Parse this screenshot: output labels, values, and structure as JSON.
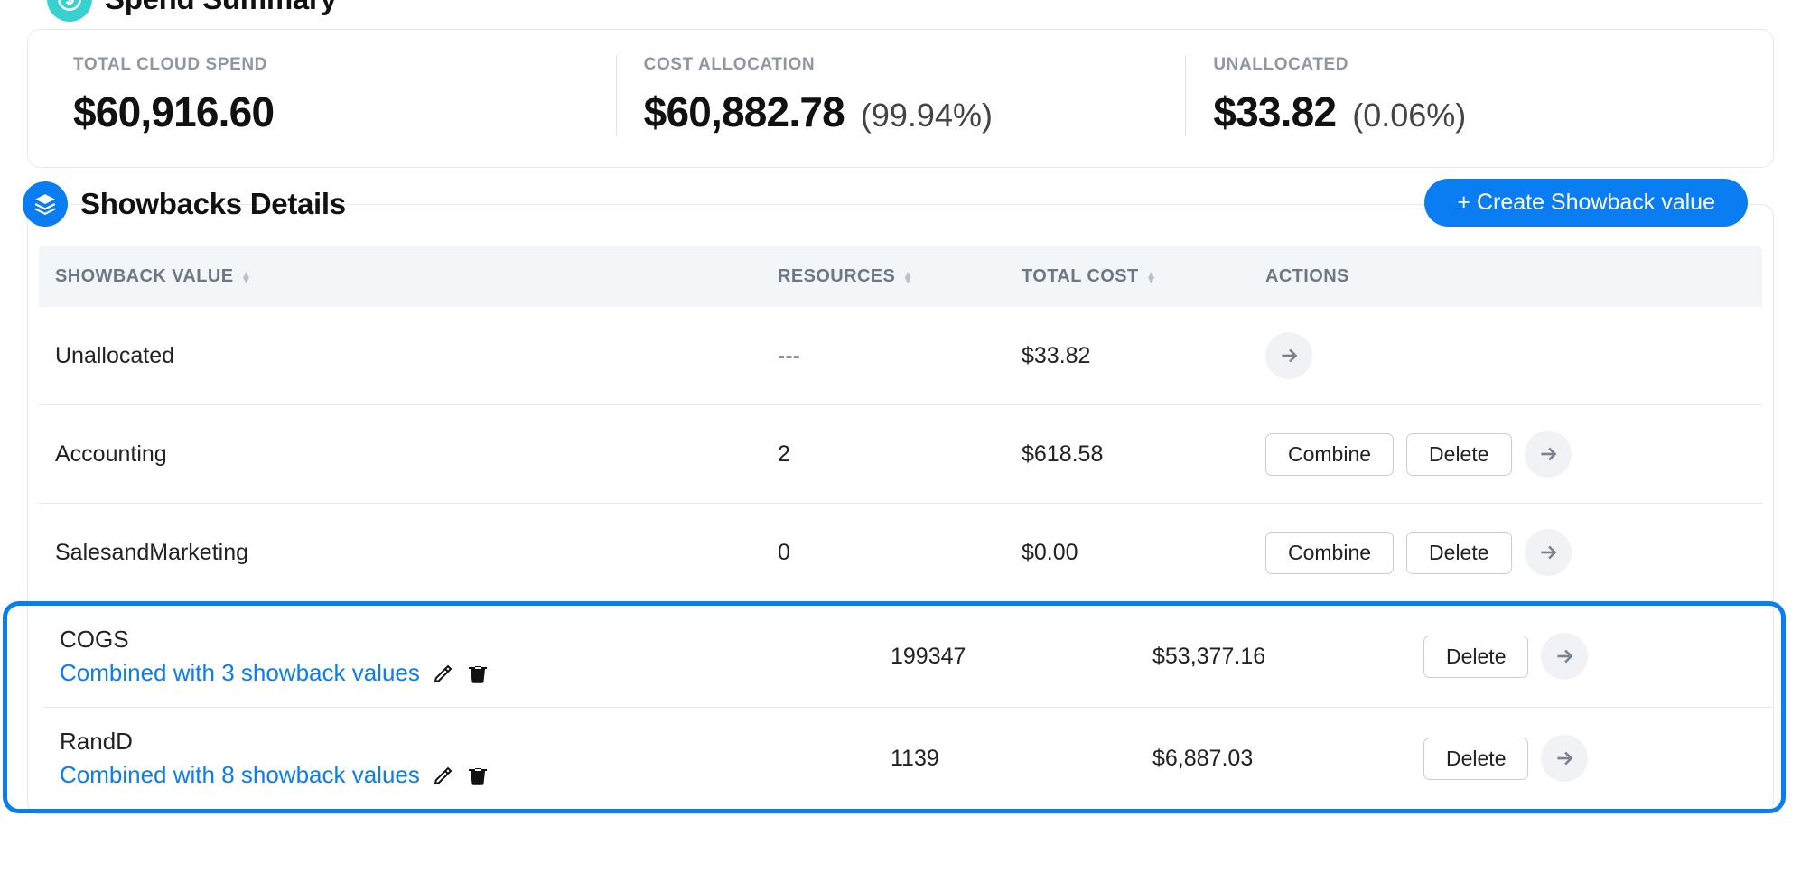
{
  "spendSummary": {
    "title": "Spend Summary",
    "metrics": [
      {
        "label": "TOTAL CLOUD SPEND",
        "value": "$60,916.60",
        "pct": ""
      },
      {
        "label": "COST ALLOCATION",
        "value": "$60,882.78",
        "pct": "(99.94%)"
      },
      {
        "label": "UNALLOCATED",
        "value": "$33.82",
        "pct": "(0.06%)"
      }
    ]
  },
  "showbacks": {
    "title": "Showbacks Details",
    "createLabel": "+ Create Showback value",
    "columns": {
      "showback": "SHOWBACK VALUE",
      "resources": "RESOURCES",
      "cost": "TOTAL COST",
      "actions": "ACTIONS"
    },
    "buttons": {
      "combine": "Combine",
      "delete": "Delete"
    },
    "rows": [
      {
        "name": "Unallocated",
        "resources": "---",
        "cost": "$33.82",
        "combine": false,
        "delete": false
      },
      {
        "name": "Accounting",
        "resources": "2",
        "cost": "$618.58",
        "combine": true,
        "delete": true
      },
      {
        "name": "SalesandMarketing",
        "resources": "0",
        "cost": "$0.00",
        "combine": true,
        "delete": true
      }
    ],
    "combinedRows": [
      {
        "name": "COGS",
        "sub": "Combined with 3 showback values",
        "resources": "199347",
        "cost": "$53,377.16"
      },
      {
        "name": "RandD",
        "sub": "Combined with 8 showback values",
        "resources": "1139",
        "cost": "$6,887.03"
      }
    ]
  }
}
